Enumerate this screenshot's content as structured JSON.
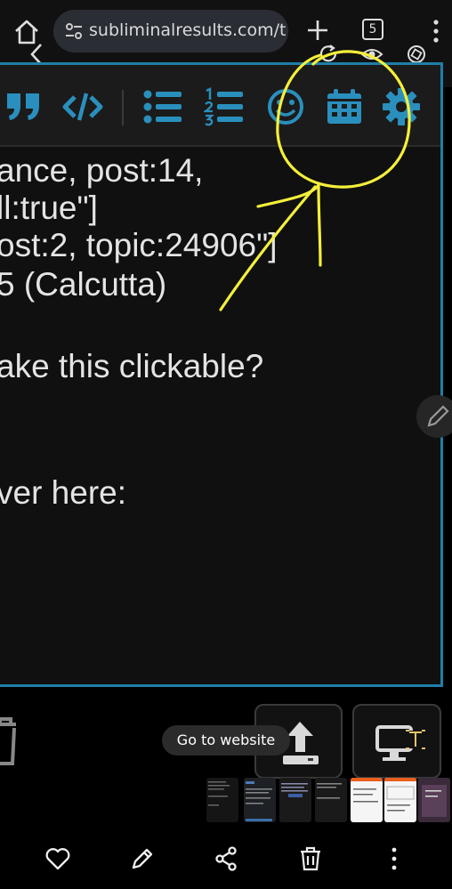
{
  "browser": {
    "url": "subliminalresults.com/t",
    "tab_count": "5"
  },
  "toolbar": {
    "icons": [
      "quote-icon",
      "code-icon",
      "bullet-list-icon",
      "numbered-list-icon",
      "emoji-icon",
      "calendar-icon",
      "gear-icon"
    ]
  },
  "content": {
    "lines": [
      "ance, post:14,",
      "ll:true\"]",
      "ost:2, topic:24906\"]",
      "5 (Calcutta)",
      "ake this clickable?",
      "ver here:"
    ]
  },
  "actions": {
    "goto_label": "Go to website"
  },
  "colors": {
    "accent": "#2a8fbd",
    "frame": "#1f7fa8",
    "annotation": "#f4ef3a"
  }
}
